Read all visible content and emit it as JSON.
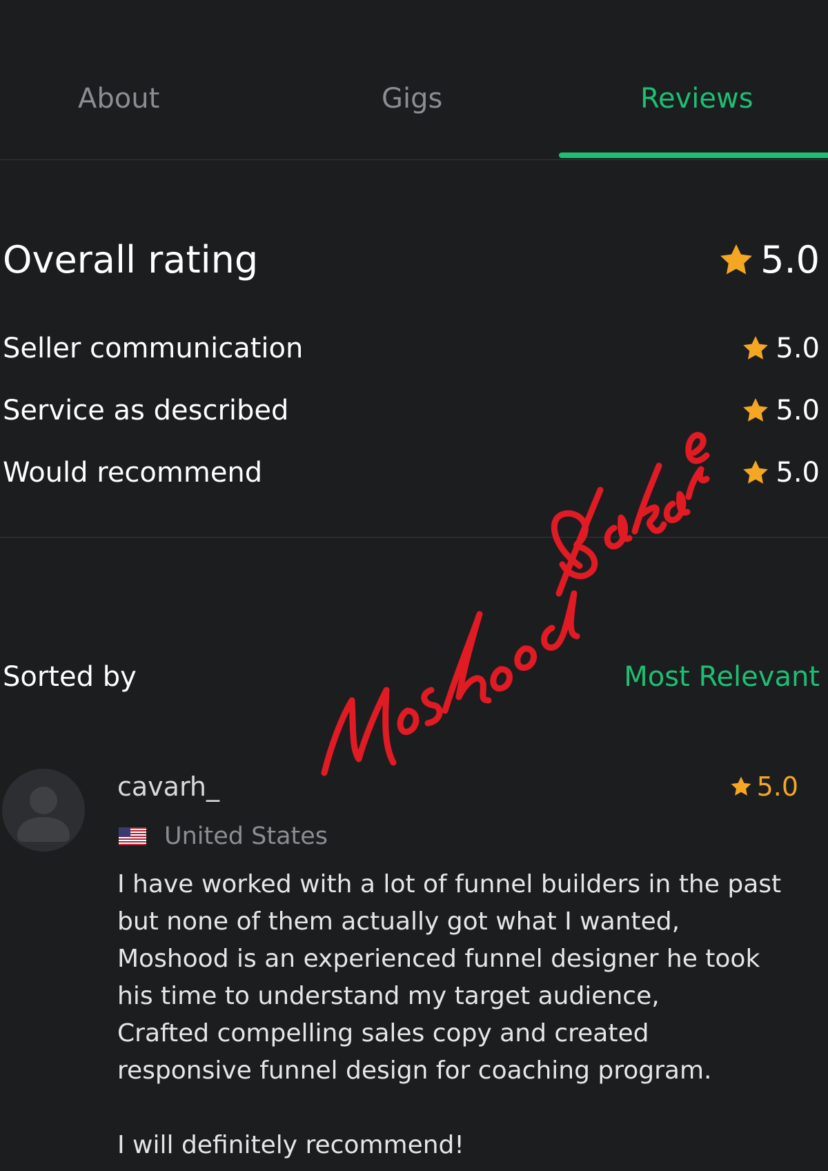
{
  "tabs": [
    {
      "label": "About",
      "active": false
    },
    {
      "label": "Gigs",
      "active": false
    },
    {
      "label": "Reviews",
      "active": true
    }
  ],
  "ratings": {
    "overall": {
      "label": "Overall rating",
      "value": "5.0"
    },
    "breakdown": [
      {
        "label": "Seller communication",
        "value": "5.0"
      },
      {
        "label": "Service as described",
        "value": "5.0"
      },
      {
        "label": "Would recommend",
        "value": "5.0"
      }
    ]
  },
  "sort": {
    "label": "Sorted by",
    "value": "Most Relevant"
  },
  "review": {
    "username": "cavarh_",
    "rating": "5.0",
    "country": "United States",
    "country_flag": "us-flag-icon",
    "text": "I have worked with a lot of funnel builders in the past\nbut none of them actually got what I wanted,\nMoshood is an experienced funnel designer he took\nhis time to understand my target audience,\nCrafted compelling sales copy and created\nresponsive funnel design for coaching program.\n\nI will definitely recommend!"
  },
  "watermark": {
    "text": "Moshood Bakare"
  },
  "colors": {
    "background": "#1c1d1f",
    "accent": "#1dbf73",
    "star": "#f5a623",
    "muted": "#8a8d91",
    "watermark": "#e01b24"
  }
}
